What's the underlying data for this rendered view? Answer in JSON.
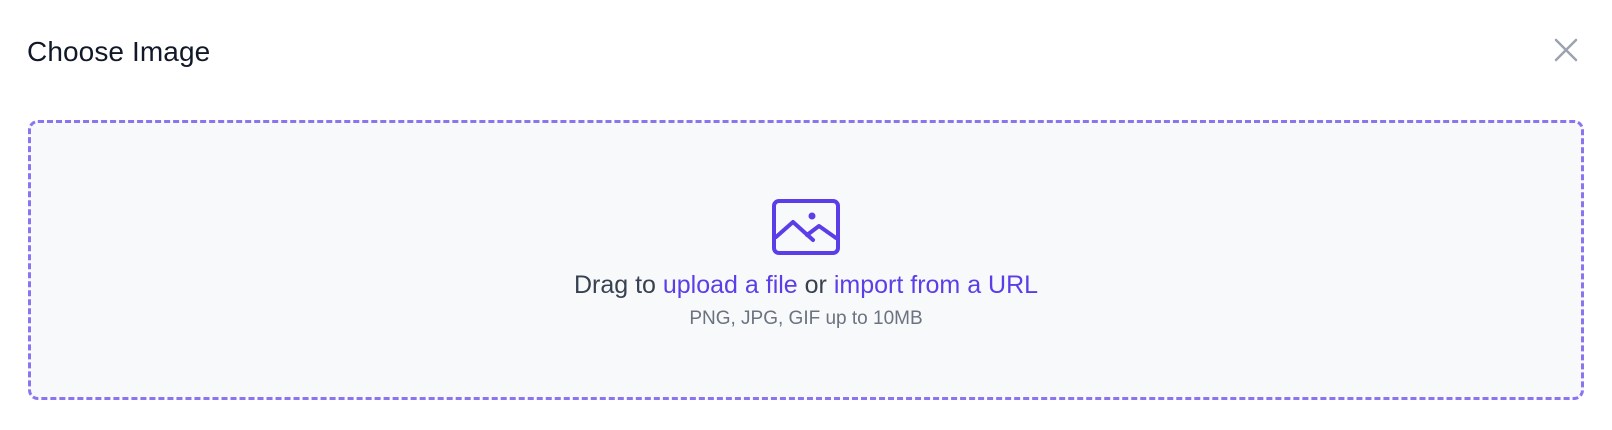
{
  "dialog": {
    "title": "Choose Image",
    "close_icon": "close-icon"
  },
  "dropzone": {
    "icon": "image-icon",
    "prompt_prefix": "Drag to",
    "upload_link": "upload a file",
    "connector": "or",
    "import_link": "import from a URL",
    "hint": "PNG, JPG, GIF up to 10MB"
  },
  "colors": {
    "accent": "#5b3ee8",
    "dropzone_border": "#8b74f0",
    "dropzone_background": "#f8f9fa",
    "close_icon": "#9ca3af"
  }
}
